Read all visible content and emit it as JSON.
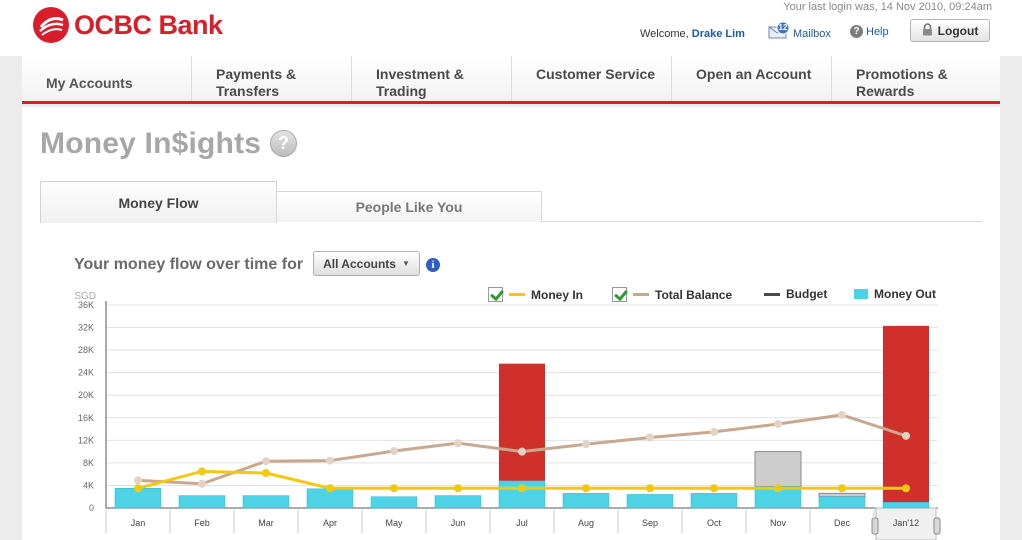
{
  "header": {
    "brand": "OCBC Bank",
    "last_login": "Your last login was, 14 Nov 2010, 09:24am",
    "welcome_prefix": "Welcome,",
    "user_name": "Drake Lim",
    "mailbox_label": "Mailbox",
    "mailbox_count": "12",
    "help_label": "Help",
    "logout_label": "Logout"
  },
  "nav": {
    "items": [
      {
        "label": "My Accounts"
      },
      {
        "label": "Payments & Transfers"
      },
      {
        "label": "Investment & Trading"
      },
      {
        "label": "Customer Service"
      },
      {
        "label": "Open an Account"
      },
      {
        "label": "Promotions & Rewards"
      }
    ]
  },
  "page": {
    "title": "Money In$ights",
    "help_symbol": "?",
    "tabs": [
      {
        "label": "Money Flow",
        "active": true
      },
      {
        "label": "People Like You",
        "active": false
      }
    ],
    "flow_heading": "Your money flow over time for",
    "accounts_select": "All Accounts",
    "info_symbol": "i"
  },
  "legend": [
    {
      "label": "Money In",
      "checked": true,
      "color": "#f2c811"
    },
    {
      "label": "Total Balance",
      "checked": true,
      "color": "#c8a88e"
    },
    {
      "label": "Budget",
      "checked": false,
      "color": "#4a4a4a"
    },
    {
      "label": "Money Out",
      "checked": false,
      "color": "#4ed2e6"
    }
  ],
  "colors": {
    "brand_red": "#d81e2a",
    "bar_over": "#d0302a",
    "bar_budget": "#cdcdcd",
    "link_blue": "#1c5a9a"
  },
  "chart_data": {
    "type": "bar",
    "unit_label": "SGD",
    "ylim": [
      0,
      36000
    ],
    "y_ticks": [
      "0",
      "4K",
      "8K",
      "12K",
      "16K",
      "20K",
      "24K",
      "28K",
      "32K",
      "36K"
    ],
    "categories": [
      "Jan",
      "Feb",
      "Mar",
      "Apr",
      "May",
      "Jun",
      "Jul",
      "Aug",
      "Sep",
      "Oct",
      "Nov",
      "Dec",
      "Jan'12"
    ],
    "money_out": [
      3500,
      2200,
      2200,
      3400,
      2000,
      2200,
      4800,
      2600,
      2400,
      2600,
      3800,
      2000,
      1000
    ],
    "money_out_over_budget": [
      0,
      0,
      0,
      0,
      0,
      0,
      20800,
      0,
      0,
      0,
      0,
      0,
      31300
    ],
    "budget_gap": [
      0,
      0,
      0,
      0,
      0,
      0,
      0,
      0,
      0,
      0,
      6200,
      600,
      0
    ],
    "money_in": [
      3500,
      6500,
      6200,
      3500,
      3500,
      3500,
      3500,
      3500,
      3500,
      3500,
      3500,
      3500,
      3500
    ],
    "total_balance": [
      4900,
      4300,
      8300,
      8400,
      10100,
      11500,
      10000,
      11300,
      12500,
      13500,
      14900,
      16500,
      12800
    ],
    "grid": true
  }
}
